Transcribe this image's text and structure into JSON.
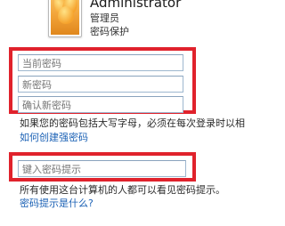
{
  "user": {
    "name": "Administrator",
    "role": "管理员",
    "status": "密码保护"
  },
  "password_form": {
    "current_placeholder": "当前密码",
    "new_placeholder": "新密码",
    "confirm_placeholder": "确认新密码",
    "hint_placeholder": "键入密码提示",
    "case_note": "如果您的密码包括大写字母，必须在每次登录时以相",
    "strong_link": "如何创建强密码",
    "visibility_note": "所有使用这台计算机的人都可以看见密码提示。",
    "hint_link": "密码提示是什么?"
  },
  "colors": {
    "annotation_red": "#e0222c",
    "link_blue": "#1b61b5"
  }
}
